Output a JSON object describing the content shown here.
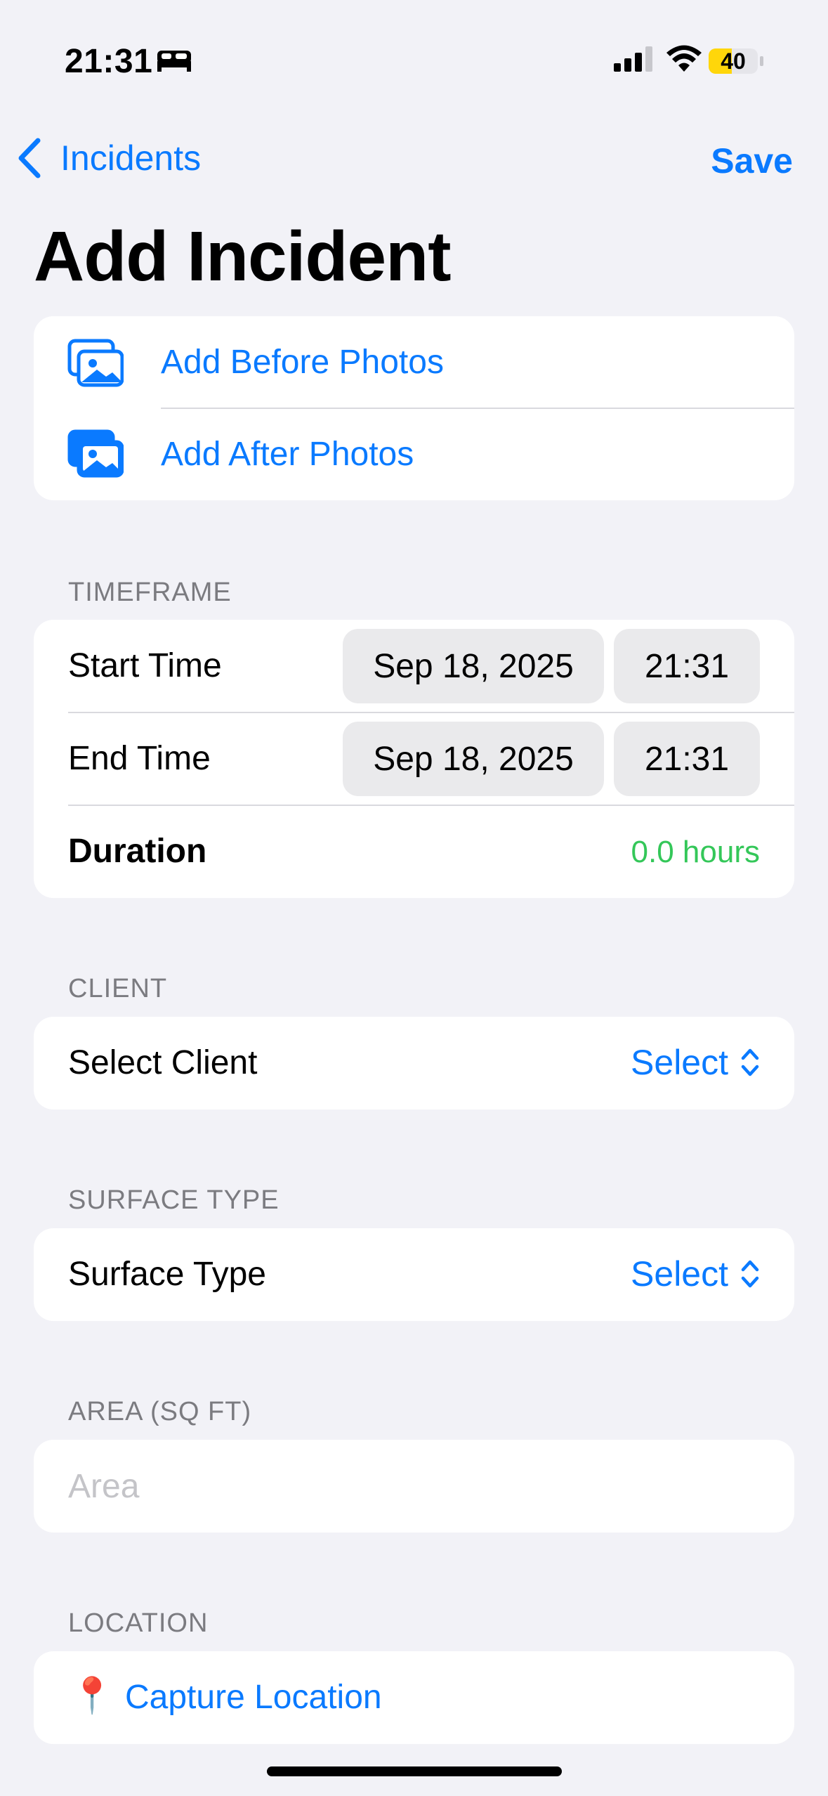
{
  "status_bar": {
    "time": "21:31",
    "battery": "40"
  },
  "nav": {
    "back_label": "Incidents",
    "save_label": "Save"
  },
  "page_title": "Add Incident",
  "photos": {
    "before_label": "Add Before Photos",
    "after_label": "Add After Photos"
  },
  "timeframe": {
    "header": "TIMEFRAME",
    "start_label": "Start Time",
    "start_date": "Sep 18, 2025",
    "start_time": "21:31",
    "end_label": "End Time",
    "end_date": "Sep 18, 2025",
    "end_time": "21:31",
    "duration_label": "Duration",
    "duration_value": "0.0 hours"
  },
  "client": {
    "header": "CLIENT",
    "label": "Select Client",
    "value": "Select"
  },
  "surface": {
    "header": "SURFACE TYPE",
    "label": "Surface Type",
    "value": "Select"
  },
  "area": {
    "header": "AREA (SQ FT)",
    "placeholder": "Area"
  },
  "location": {
    "header": "LOCATION",
    "pin": "📍",
    "label": "Capture Location"
  },
  "colors": {
    "accent": "#0a7aff",
    "duration": "#34c759",
    "battery": "#ffd60a"
  },
  "icons": [
    "bed-icon",
    "cellular-signal-icon",
    "wifi-icon",
    "battery-icon",
    "chevron-left-icon",
    "photos-icon",
    "chevron-up-down-icon",
    "pin-icon"
  ]
}
